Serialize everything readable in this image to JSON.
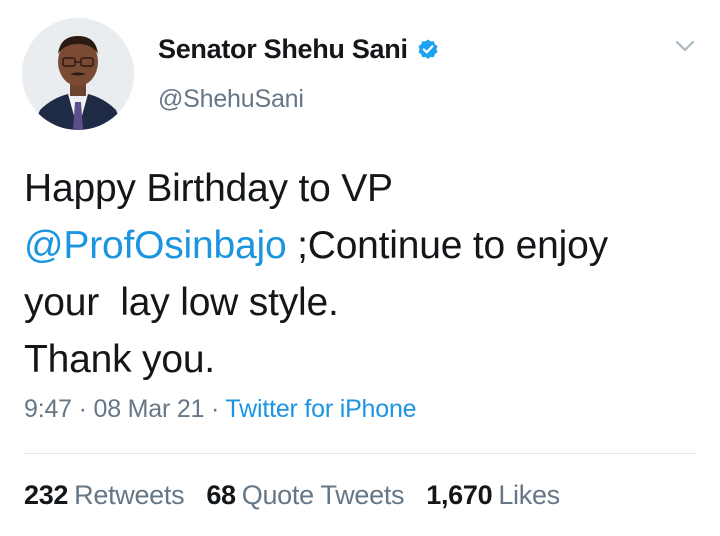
{
  "author": {
    "display_name": "Senator Shehu Sani",
    "handle": "@ShehuSani",
    "verified": true,
    "avatar_icon": "profile-photo"
  },
  "tweet": {
    "line1": "Happy Birthday to VP",
    "mention": "@ProfOsinbajo",
    "line2_rest": " ;Continue to enjoy",
    "line3": "your  lay low style.",
    "line4": "Thank you."
  },
  "meta": {
    "time": "9:47",
    "sep1": " · ",
    "date": "08 Mar 21",
    "sep2": " · ",
    "source": "Twitter for iPhone"
  },
  "stats": {
    "retweets_count": "232",
    "retweets_label": "Retweets",
    "quotes_count": "68",
    "quotes_label": "Quote Tweets",
    "likes_count": "1,670",
    "likes_label": "Likes"
  },
  "colors": {
    "link": "#1b95e0",
    "secondary": "#657786",
    "text": "#14171a",
    "verified": "#1da1f2",
    "divider": "#e1e8ed"
  }
}
